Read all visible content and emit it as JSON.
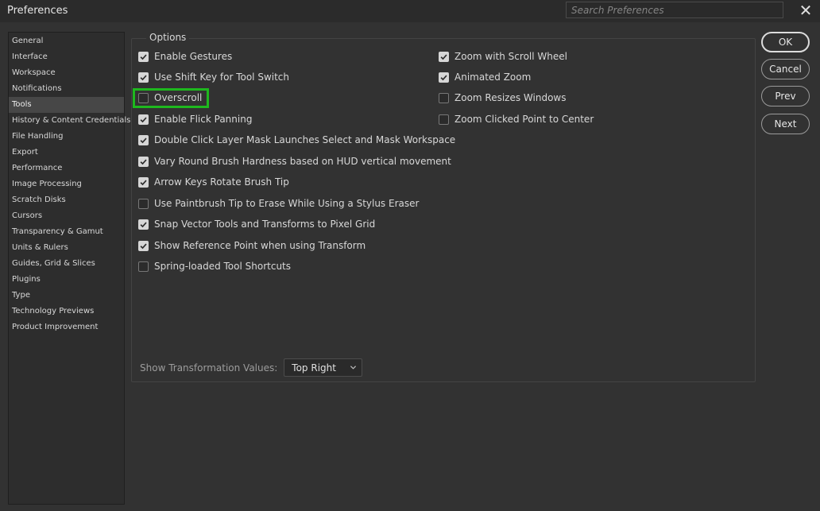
{
  "window": {
    "title": "Preferences",
    "search_placeholder": "Search Preferences"
  },
  "sidebar": {
    "items": [
      {
        "label": "General"
      },
      {
        "label": "Interface"
      },
      {
        "label": "Workspace"
      },
      {
        "label": "Notifications"
      },
      {
        "label": "Tools",
        "active": true
      },
      {
        "label": "History & Content Credentials"
      },
      {
        "label": "File Handling"
      },
      {
        "label": "Export"
      },
      {
        "label": "Performance"
      },
      {
        "label": "Image Processing"
      },
      {
        "label": "Scratch Disks"
      },
      {
        "label": "Cursors"
      },
      {
        "label": "Transparency & Gamut"
      },
      {
        "label": "Units & Rulers"
      },
      {
        "label": "Guides, Grid & Slices"
      },
      {
        "label": "Plugins"
      },
      {
        "label": "Type"
      },
      {
        "label": "Technology Previews"
      },
      {
        "label": "Product Improvement"
      }
    ]
  },
  "options": {
    "group_label": "Options",
    "left": [
      {
        "label": "Enable Gestures",
        "checked": true
      },
      {
        "label": "Use Shift Key for Tool Switch",
        "checked": true
      },
      {
        "label": "Overscroll",
        "checked": false
      },
      {
        "label": "Enable Flick Panning",
        "checked": true
      },
      {
        "label": "Double Click Layer Mask Launches Select and Mask Workspace",
        "checked": true
      },
      {
        "label": "Vary Round Brush Hardness based on HUD vertical movement",
        "checked": true
      },
      {
        "label": "Arrow Keys Rotate Brush Tip",
        "checked": true
      },
      {
        "label": "Use Paintbrush Tip to Erase While Using a Stylus Eraser",
        "checked": false
      },
      {
        "label": "Snap Vector Tools and Transforms to Pixel Grid",
        "checked": true
      },
      {
        "label": "Show Reference Point when using Transform",
        "checked": true
      },
      {
        "label": "Spring-loaded Tool Shortcuts",
        "checked": false
      }
    ],
    "right": [
      {
        "label": "Zoom with Scroll Wheel",
        "checked": true
      },
      {
        "label": "Animated Zoom",
        "checked": true
      },
      {
        "label": "Zoom Resizes Windows",
        "checked": false
      },
      {
        "label": "Zoom Clicked Point to Center",
        "checked": false
      }
    ],
    "transform_label": "Show Transformation Values:",
    "transform_value": "Top Right"
  },
  "buttons": {
    "ok": "OK",
    "cancel": "Cancel",
    "prev": "Prev",
    "next": "Next"
  },
  "colors": {
    "highlight": "#1eb81e"
  },
  "icons": {
    "close": "close-icon",
    "check": "checkmark-icon",
    "dropdown": "chevron-down-icon"
  }
}
